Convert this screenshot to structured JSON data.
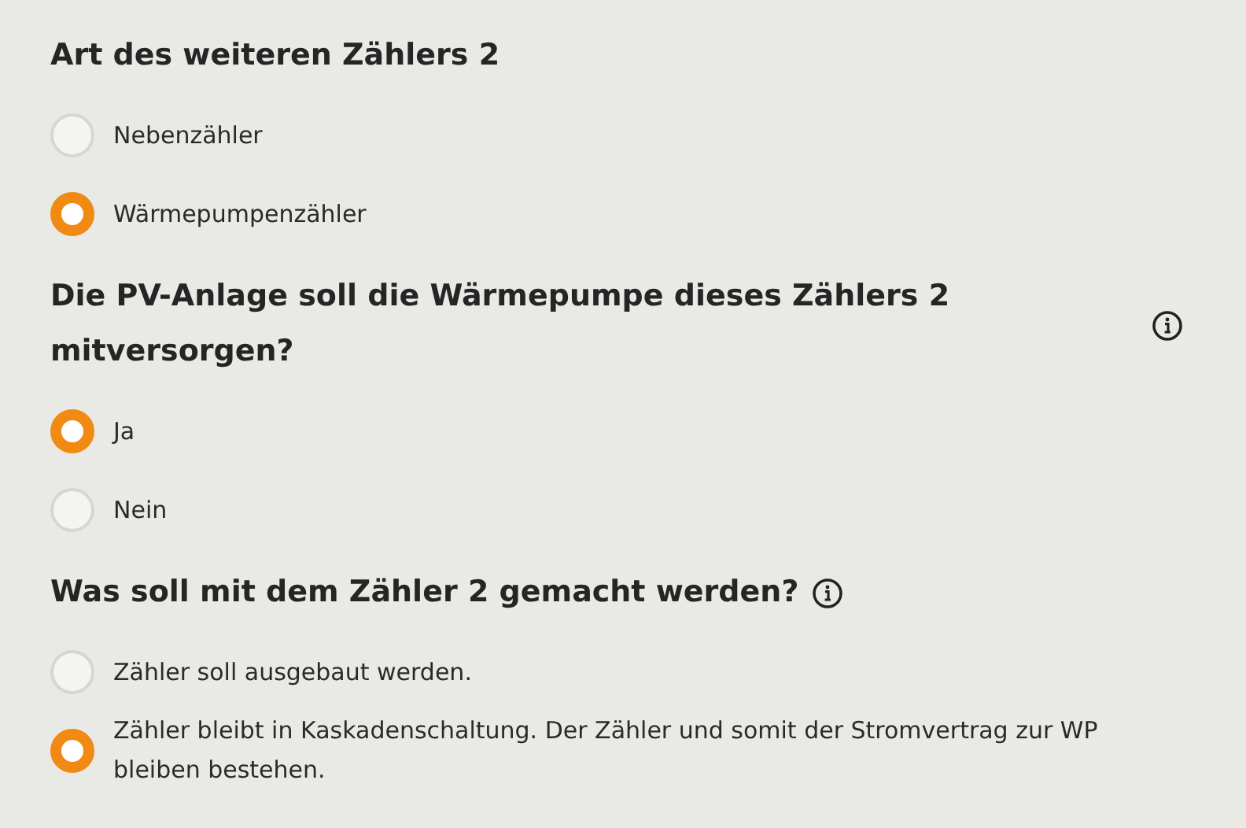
{
  "questions": [
    {
      "title": "Art des weiteren Zählers 2",
      "kind": "plain",
      "options": [
        {
          "label": "Nebenzähler",
          "selected": false
        },
        {
          "label": "Wärmepumpenzähler",
          "selected": true
        }
      ]
    },
    {
      "title": "Die PV-Anlage soll die Wärmepumpe dieses Zählers 2 mitversorgen?",
      "kind": "info_right",
      "options": [
        {
          "label": "Ja",
          "selected": true
        },
        {
          "label": "Nein",
          "selected": false
        }
      ]
    },
    {
      "title": "Was soll mit dem Zähler 2 gemacht werden?",
      "kind": "info_inline",
      "options": [
        {
          "label": "Zähler soll ausgebaut werden.",
          "selected": false
        },
        {
          "label": "Zähler bleibt in Kaskadenschaltung. Der Zähler und somit der Stromvertrag zur WP bleiben bestehen.",
          "selected": true
        }
      ]
    }
  ]
}
